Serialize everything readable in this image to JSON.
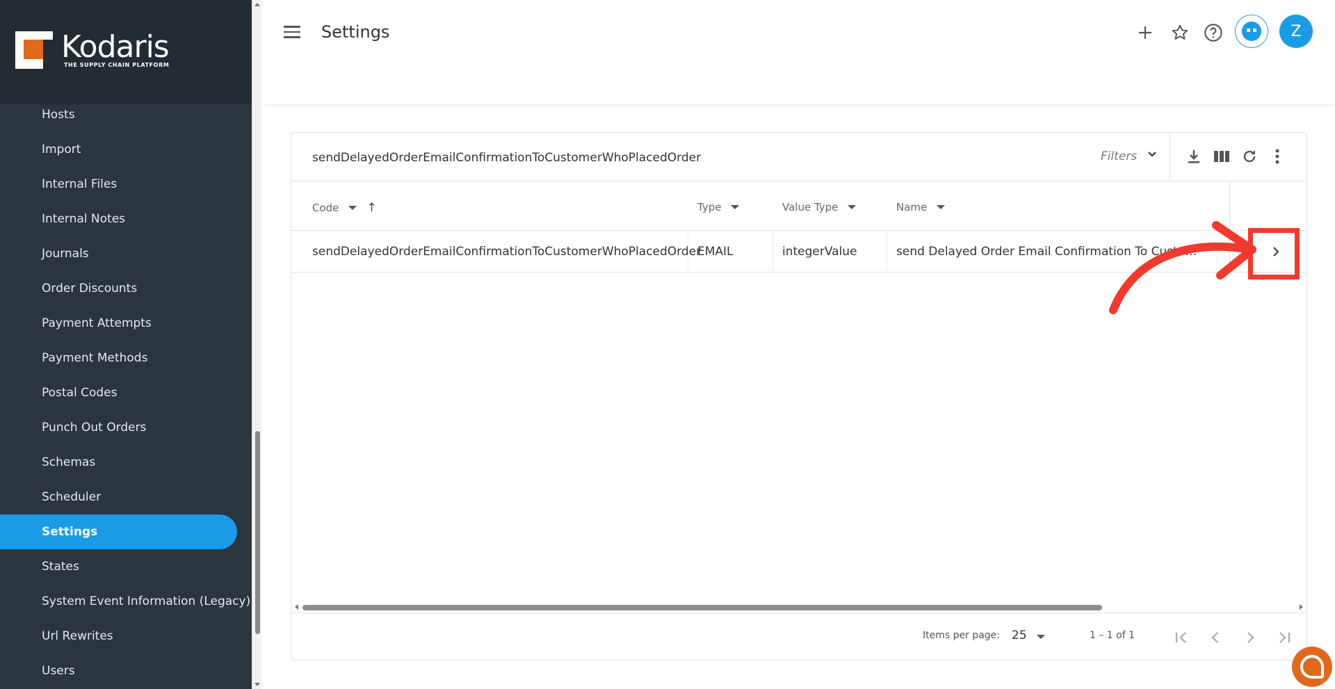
{
  "brand": {
    "name": "Kodaris",
    "tagline": "THE SUPPLY CHAIN PLATFORM",
    "accent": "#1a9be6",
    "logo_orange": "#e0691f"
  },
  "sidebar": {
    "items": [
      {
        "label": "Hosts",
        "active": false
      },
      {
        "label": "Import",
        "active": false
      },
      {
        "label": "Internal Files",
        "active": false
      },
      {
        "label": "Internal Notes",
        "active": false
      },
      {
        "label": "Journals",
        "active": false
      },
      {
        "label": "Order Discounts",
        "active": false
      },
      {
        "label": "Payment Attempts",
        "active": false
      },
      {
        "label": "Payment Methods",
        "active": false
      },
      {
        "label": "Postal Codes",
        "active": false
      },
      {
        "label": "Punch Out Orders",
        "active": false
      },
      {
        "label": "Schemas",
        "active": false
      },
      {
        "label": "Scheduler",
        "active": false
      },
      {
        "label": "Settings",
        "active": true
      },
      {
        "label": "States",
        "active": false
      },
      {
        "label": "System Event Information (Legacy)",
        "active": false
      },
      {
        "label": "Url Rewrites",
        "active": false
      },
      {
        "label": "Users",
        "active": false
      }
    ]
  },
  "header": {
    "title": "Settings",
    "avatar_initial": "Z",
    "icons": [
      "add-icon",
      "star-icon",
      "help-icon",
      "bot-icon"
    ]
  },
  "grid": {
    "search_value": "sendDelayedOrderEmailConfirmationToCustomerWhoPlacedOrder",
    "filters_label": "Filters",
    "columns": [
      {
        "label": "Code",
        "sorted": "asc"
      },
      {
        "label": "Type"
      },
      {
        "label": "Value Type"
      },
      {
        "label": "Name"
      }
    ],
    "rows": [
      {
        "code": "sendDelayedOrderEmailConfirmationToCustomerWhoPlacedOrder",
        "type": "EMAIL",
        "value_type": "integerValue",
        "name": "send Delayed Order Email Confirmation To Custo…"
      }
    ],
    "pagination": {
      "items_per_page_label": "Items per page:",
      "items_per_page": "25",
      "range": "1 – 1 of 1"
    }
  },
  "annotation": {
    "color": "#f03a2e"
  }
}
